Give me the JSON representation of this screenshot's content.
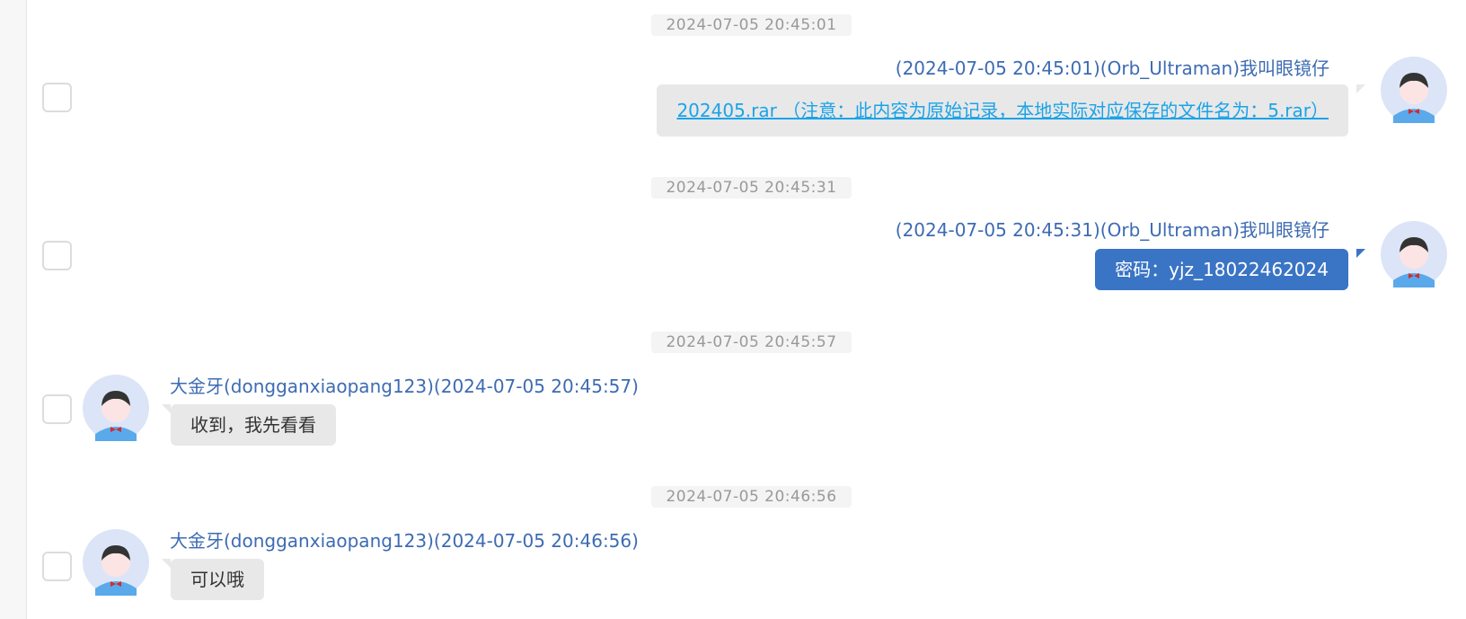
{
  "messages": [
    {
      "timestamp": "2024-07-05 20:45:01",
      "sender": "(2024-07-05 20:45:01)(Orb_Ultraman)我叫眼镜仔",
      "text": "202405.rar （注意：此内容为原始记录，本地实际对应保存的文件名为：5.rar）",
      "side": "right",
      "type": "file-link"
    },
    {
      "timestamp": "2024-07-05 20:45:31",
      "sender": "(2024-07-05 20:45:31)(Orb_Ultraman)我叫眼镜仔",
      "text": "密码：yjz_18022462024",
      "side": "right",
      "type": "text"
    },
    {
      "timestamp": "2024-07-05 20:45:57",
      "sender": "大金牙(dongganxiaopang123)(2024-07-05 20:45:57)",
      "text": "收到，我先看看",
      "side": "left",
      "type": "text"
    },
    {
      "timestamp": "2024-07-05 20:46:56",
      "sender": "大金牙(dongganxiaopang123)(2024-07-05 20:46:56)",
      "text": "可以哦",
      "side": "left",
      "type": "text"
    }
  ],
  "colors": {
    "sender_name": "#3d6bb3",
    "own_bubble": "#3a74c4",
    "other_bubble": "#e8e8e8",
    "file_link": "#1aa3e8",
    "timestamp_text": "#999999"
  },
  "icons": {
    "avatar": "avatar-icon",
    "checkbox": "checkbox"
  }
}
